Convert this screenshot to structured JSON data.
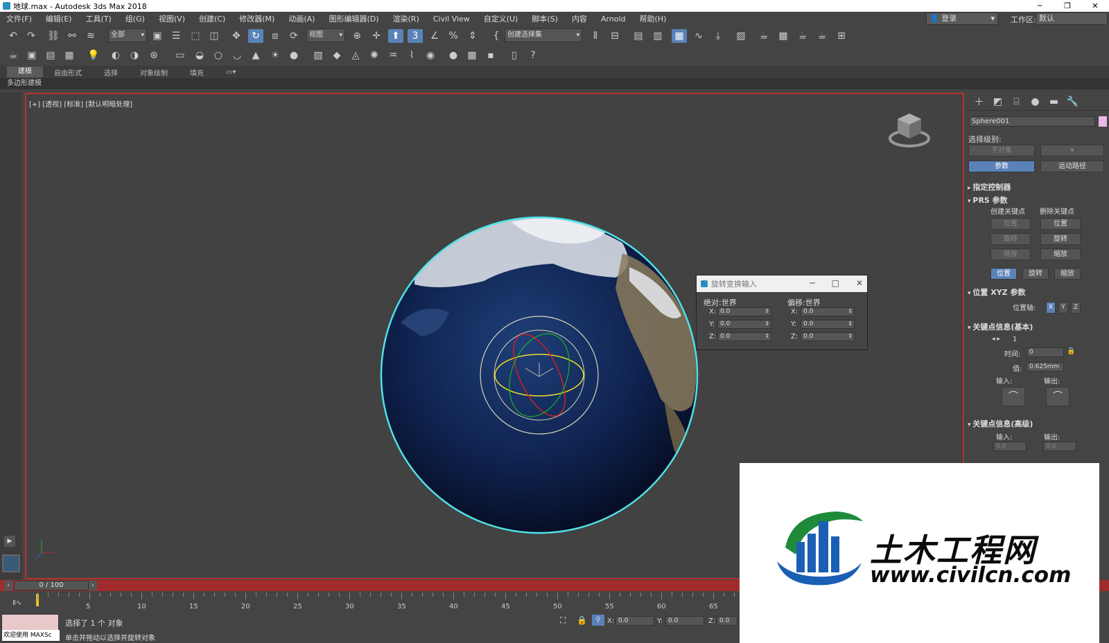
{
  "window": {
    "title": "地球.max - Autodesk 3ds Max 2018",
    "controls": [
      "─",
      "❐",
      "✕"
    ]
  },
  "menu": {
    "items": [
      "文件(F)",
      "编辑(E)",
      "工具(T)",
      "组(G)",
      "视图(V)",
      "创建(C)",
      "修改器(M)",
      "动画(A)",
      "图形编辑器(D)",
      "渲染(R)",
      "Civil View",
      "自定义(U)",
      "脚本(S)",
      "内容",
      "Arnold",
      "帮助(H)"
    ],
    "login": "登录",
    "workspace_label": "工作区:",
    "workspace_value": "默认"
  },
  "toolbar": {
    "selection_filter": "全部",
    "coord_system": "视图",
    "named_selection": "创建选择集"
  },
  "ribbon": {
    "tabs": [
      "建模",
      "自由形式",
      "选择",
      "对象绘制",
      "填充"
    ],
    "sub_label": "多边形建模"
  },
  "viewport": {
    "label": "[+] [透视] [标准] [默认明暗处理]"
  },
  "command_panel": {
    "object_name": "Sphere001",
    "selection_level_label": "选择级别:",
    "sub_object": "子对象",
    "params_button": "参数",
    "trajectory_button": "运动路径",
    "rollout_assign": "指定控制器",
    "rollout_prs": "PRS 参数",
    "create_key_label": "创建关键点",
    "delete_key_label": "删除关键点",
    "position": "位置",
    "rotation": "旋转",
    "scale": "缩放",
    "rollout_xyz": "位置 XYZ 参数",
    "position_axis_label": "位置轴:",
    "axis_x": "X",
    "axis_y": "Y",
    "axis_z": "Z",
    "rollout_key_basic": "关键点信息(基本)",
    "key_number": "1",
    "time_label": "时间:",
    "time_value": "0",
    "value_label": "值:",
    "value_value": "0.625mm",
    "in_label": "输入:",
    "out_label": "输出:",
    "rollout_key_adv": "关键点信息(高级)",
    "adv_in_value": "0.0",
    "adv_out_value": "0.0"
  },
  "rotate_dialog": {
    "title": "旋转变换输入",
    "absolute_label": "绝对:世界",
    "offset_label": "偏移:世界",
    "axis_x": "X:",
    "axis_y": "Y:",
    "axis_z": "Z:",
    "values": [
      "0.0",
      "0.0",
      "0.0",
      "0.0",
      "0.0",
      "0.0"
    ]
  },
  "timeline": {
    "frame_display": "0 / 100",
    "tick_labels": [
      "5",
      "10",
      "15",
      "20",
      "25",
      "30",
      "35",
      "40",
      "45",
      "50",
      "55",
      "60",
      "65"
    ]
  },
  "status": {
    "maxscript_label": "欢迎使用 MAXSc",
    "selected_text": "选择了 1 个 对象",
    "hint_text": "单击并拖动以选择并旋转对象",
    "x_label": "X:",
    "y_label": "Y:",
    "z_label": "Z:",
    "x_value": "0.0",
    "y_value": "0.0",
    "z_value": "0.0"
  },
  "watermark": {
    "brand": "土木工程网",
    "url": "www.civilcn.com"
  },
  "colors": {
    "accent": "#5b82b8",
    "viewport_border": "#b83030",
    "selection_outline": "#4fe3e8",
    "time_slider": "#a12b2b"
  }
}
